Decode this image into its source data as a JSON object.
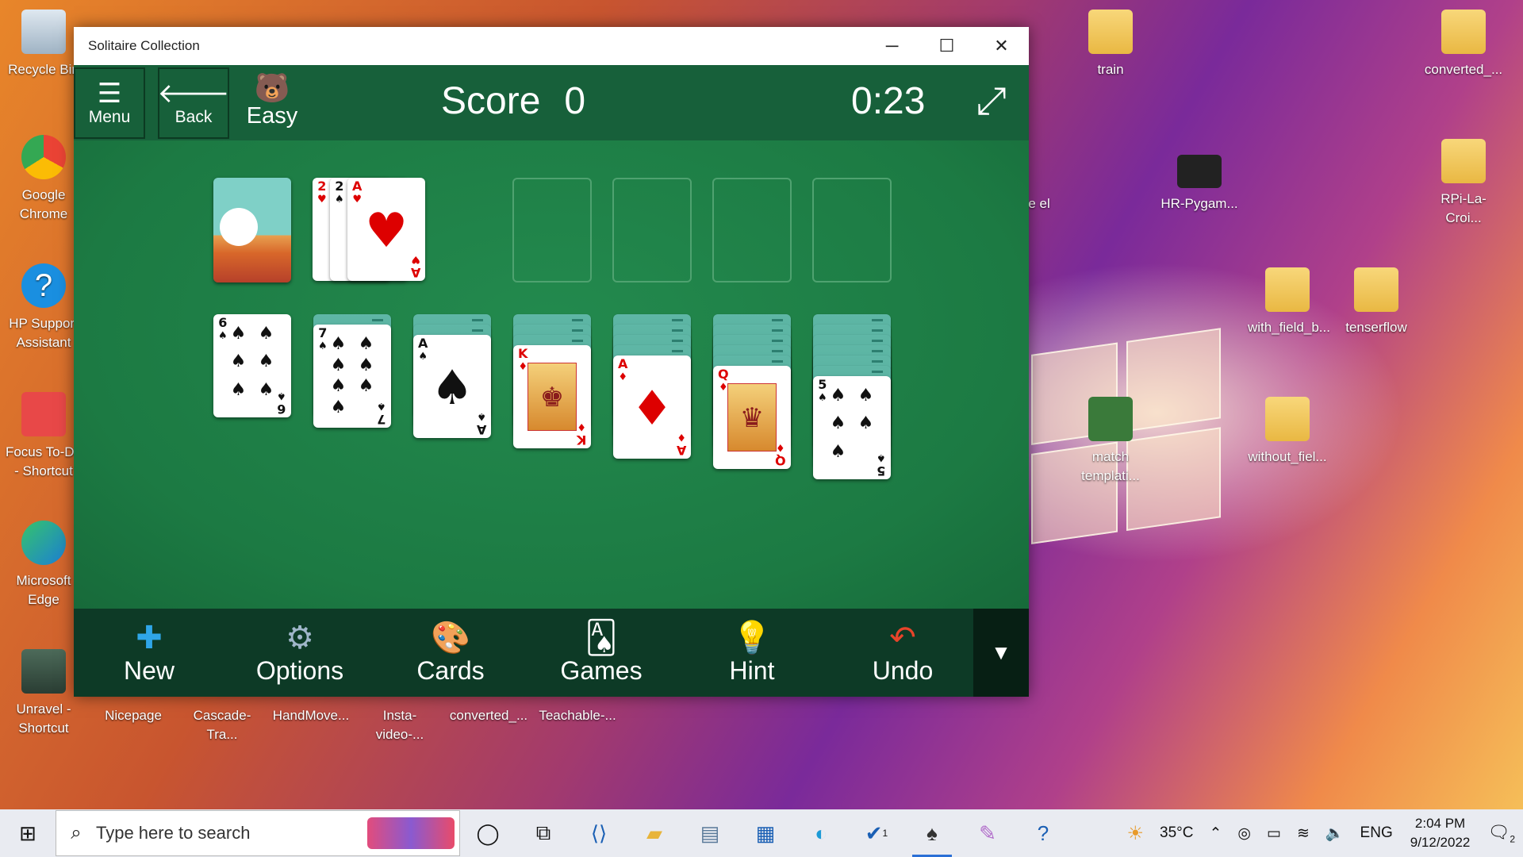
{
  "window": {
    "title": "Solitaire Collection",
    "minimize_icon": "minimize-icon",
    "maximize_icon": "maximize-icon",
    "close_icon": "close-icon"
  },
  "toolbar": {
    "menu_label": "Menu",
    "back_label": "Back",
    "mode_label": "Easy",
    "score_label": "Score",
    "score_value": "0",
    "timer": "0:23"
  },
  "board": {
    "waste": [
      {
        "rank": "2",
        "suit": "♥",
        "color": "red"
      },
      {
        "rank": "2",
        "suit": "♠",
        "color": "black"
      },
      {
        "rank": "A",
        "suit": "♥",
        "color": "red"
      }
    ],
    "tableau": [
      {
        "rank": "6",
        "suit": "♠",
        "color": "black",
        "hidden": 0
      },
      {
        "rank": "7",
        "suit": "♠",
        "color": "black",
        "hidden": 1
      },
      {
        "rank": "A",
        "suit": "♠",
        "color": "black",
        "hidden": 2
      },
      {
        "rank": "K",
        "suit": "♦",
        "color": "red",
        "hidden": 3
      },
      {
        "rank": "A",
        "suit": "♦",
        "color": "red",
        "hidden": 4
      },
      {
        "rank": "Q",
        "suit": "♦",
        "color": "red",
        "hidden": 5
      },
      {
        "rank": "5",
        "suit": "♠",
        "color": "black",
        "hidden": 6
      }
    ]
  },
  "bottombar": {
    "new": "New",
    "options": "Options",
    "cards": "Cards",
    "games": "Games",
    "hint": "Hint",
    "undo": "Undo"
  },
  "desktop": {
    "icons": [
      "Recycle Bin",
      "Google Chrome",
      "HP Support Assistant",
      "Focus To-Do - Shortcut",
      "Microsoft Edge",
      "Unravel - Shortcut",
      "Nicepage",
      "Cascade-Tra...",
      "HandMove...",
      "Insta-video-...",
      "converted_...",
      "Teachable-...",
      "train",
      "converted_...",
      "HR-Pygam...",
      "RPi-La-Croi...",
      "with_field_b...",
      "tenserflow",
      "match templati...",
      "without_fiel...",
      "n the el"
    ]
  },
  "taskbar": {
    "search_placeholder": "Type here to search",
    "weather": "35°C",
    "lang": "ENG",
    "time": "2:04 PM",
    "date": "9/12/2022",
    "notif_count": "2",
    "todo_badge": "1"
  }
}
